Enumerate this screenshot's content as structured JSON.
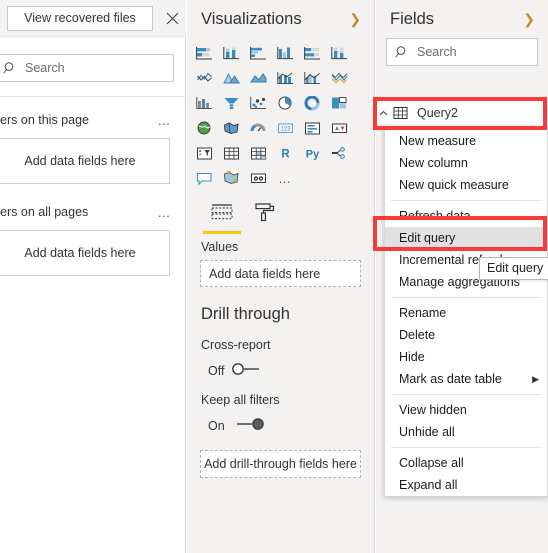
{
  "filters_pane": {
    "recovery_bar": {
      "button_label": "View recovered files",
      "close_icon": "close-icon"
    },
    "search": {
      "placeholder": "Search",
      "icon": "search-icon"
    },
    "sections": [
      {
        "title": "ilters on this page",
        "menu_icon": "…",
        "dropzone_label": "Add data fields here"
      },
      {
        "title": "ilters on all pages",
        "menu_icon": "…",
        "dropzone_label": "Add data fields here"
      }
    ]
  },
  "visualizations_pane": {
    "title": "Visualizations",
    "collapse_icon": "chevron-right-icon",
    "icons": [
      "stacked-bar-chart-icon",
      "stacked-column-chart-icon",
      "clustered-bar-chart-icon",
      "clustered-column-chart-icon",
      "100-stacked-bar-chart-icon",
      "100-stacked-column-chart-icon",
      "line-chart-icon",
      "area-chart-icon",
      "stacked-area-chart-icon",
      "line-stacked-column-chart-icon",
      "line-clustered-column-chart-icon",
      "ribbon-area-chart-icon",
      "ribbon-chart-icon",
      "funnel-chart-icon",
      "scatter-chart-icon",
      "pie-chart-icon",
      "donut-chart-icon",
      "treemap-icon",
      "map-icon",
      "filled-map-icon",
      "gauge-icon",
      "card-icon",
      "multi-row-card-icon",
      "kpi-icon",
      "slicer-icon",
      "table-icon",
      "matrix-icon",
      "r-script-visual-icon",
      "python-visual-icon",
      "decomposition-tree-icon",
      "smart-narrative-icon",
      "arcgis-map-icon",
      "key-influencers-icon",
      "more-options-icon"
    ],
    "more_options_label": "…",
    "tabs": [
      {
        "name": "Fields",
        "icon": "fields-tab-icon",
        "active": true
      },
      {
        "name": "Format",
        "icon": "paint-roller-icon",
        "active": false
      }
    ],
    "values_label": "Values",
    "values_dropzone_label": "Add data fields here",
    "drill_through": {
      "title": "Drill through",
      "cross_report_label": "Cross-report",
      "cross_report_state": "Off",
      "keep_all_filters_label": "Keep all filters",
      "keep_all_filters_state": "On",
      "dropzone_label": "Add drill-through fields here"
    }
  },
  "fields_pane": {
    "title": "Fields",
    "collapse_icon": "chevron-right-icon",
    "search": {
      "placeholder": "Search",
      "icon": "search-icon"
    },
    "table": {
      "name": "Query2",
      "icon": "table-icon",
      "collapse_icon": "chevron-up-icon"
    },
    "context_menu": [
      {
        "label": "New measure",
        "submenu": false,
        "hovered": false,
        "separator_after": false
      },
      {
        "label": "New column",
        "submenu": false,
        "hovered": false,
        "separator_after": false
      },
      {
        "label": "New quick measure",
        "submenu": false,
        "hovered": false,
        "separator_after": true
      },
      {
        "label": "Refresh data",
        "submenu": false,
        "hovered": false,
        "separator_after": false
      },
      {
        "label": "Edit query",
        "submenu": false,
        "hovered": true,
        "separator_after": false
      },
      {
        "label": "Incremental refresh",
        "submenu": false,
        "hovered": false,
        "separator_after": false
      },
      {
        "label": "Manage aggregations",
        "submenu": false,
        "hovered": false,
        "separator_after": true
      },
      {
        "label": "Rename",
        "submenu": false,
        "hovered": false,
        "separator_after": false
      },
      {
        "label": "Delete",
        "submenu": false,
        "hovered": false,
        "separator_after": false
      },
      {
        "label": "Hide",
        "submenu": false,
        "hovered": false,
        "separator_after": false
      },
      {
        "label": "Mark as date table",
        "submenu": true,
        "hovered": false,
        "separator_after": true
      },
      {
        "label": "View hidden",
        "submenu": false,
        "hovered": false,
        "separator_after": false
      },
      {
        "label": "Unhide all",
        "submenu": false,
        "hovered": false,
        "separator_after": true
      },
      {
        "label": "Collapse all",
        "submenu": false,
        "hovered": false,
        "separator_after": false
      },
      {
        "label": "Expand all",
        "submenu": false,
        "hovered": false,
        "separator_after": false
      }
    ],
    "submenu_arrow": "▶",
    "tooltip": "Edit query"
  },
  "annotations": {
    "color": "#f83a3a",
    "boxes": [
      "query2-field-row",
      "edit-query-menu-item"
    ]
  }
}
